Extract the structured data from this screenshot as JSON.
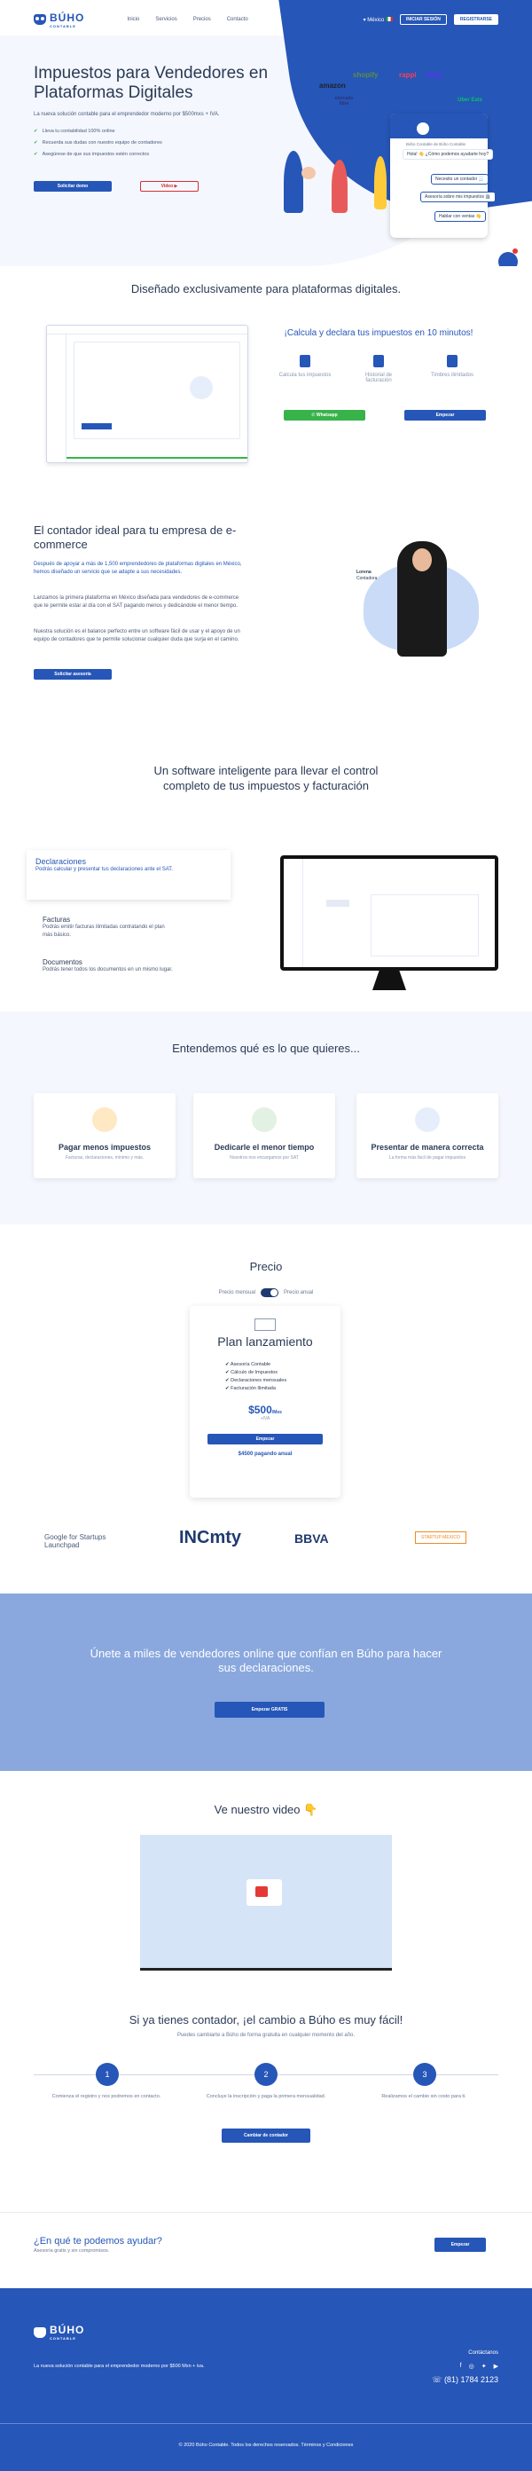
{
  "brand": {
    "name": "BÚHO",
    "sub": "CONTABLE"
  },
  "nav": {
    "links": [
      "Inicio",
      "Servicios",
      "Precios",
      "Contacto"
    ],
    "country": "México",
    "login": "INICIAR SESIÓN",
    "register": "REGISTRARSE"
  },
  "hero": {
    "title": "Impuestos para Vendedores en Plataformas Digitales",
    "subtitle": "La nueva solución contable para el emprendedor moderno por $500mxs + IVA.",
    "checks": [
      "Lleva tu contabilidad 100% online",
      "Recuerda sus dudas con nuestro equipo de contadores",
      "Asegúrese de que sus impuestos estén correctos"
    ],
    "cta_demo": "Solicitar demo",
    "cta_video": "Video",
    "brands": [
      "amazon",
      "shopify",
      "rappi",
      "shop",
      "mercado libre",
      "Uber Eats"
    ],
    "chat": {
      "header": "Búho Contable de Búho Contable",
      "greet": "Hola! 👋 ¿Cómo podemos ayudarte hoy?",
      "opt1": "Necesito un contador 🧾",
      "opt2": "Asesoría sobre mis impuestos 🏛️",
      "opt3": "Hablar con ventas 👋"
    }
  },
  "platforms": {
    "title": "Diseñado exclusivamente para plataformas digitales.",
    "headline": "¡Calcula y declara tus impuestos en 10 minutos!",
    "features": [
      "Calcula tus impuestos",
      "Historial de facturación",
      "Timbres ilimitados"
    ],
    "whatsapp": "Whatsapp",
    "start": "Empezar"
  },
  "accountant": {
    "title": "El contador ideal para tu empresa de e-commerce",
    "p1": "Después de apoyar a más de 1,500 emprendedores de plataformas digitales en México, hemos diseñado un servicio que se adapte a sus necesidades.",
    "p2": "Lanzamos la primera plataforma en México diseñada para vendedores de e-commerce que te permite estar al día con el SAT pagando menos y dedicándole el menor tiempo.",
    "p3": "Nuestra solución es el balance perfecto entre un software fácil de usar y el apoyo de un equipo de contadores que te permite solucionar cualquier duda que surja en el camino.",
    "cta": "Solicitar asesoría",
    "person_name": "Lorena",
    "person_role": "Contadora"
  },
  "software": {
    "title": "Un software inteligente para llevar el control completo de tus impuestos y facturación",
    "tabs": [
      {
        "title": "Declaraciones",
        "text": "Podrás calcular y presentar tus declaraciones ante el SAT."
      },
      {
        "title": "Facturas",
        "text": "Podrás emitir facturas ilimitadas contratando el plan más básico."
      },
      {
        "title": "Documentos",
        "text": "Podrás tener todos los documentos en un mismo lugar."
      }
    ]
  },
  "understand": {
    "title": "Entendemos qué es lo que quieres...",
    "cards": [
      {
        "title": "Pagar menos impuestos",
        "text": "Facturas, declaraciones, mínimo y más."
      },
      {
        "title": "Dedicarle el menor tiempo",
        "text": "Nosotros nos encargamos por SAT"
      },
      {
        "title": "Presentar de manera correcta",
        "text": "La forma más fácil de pagar impuestos"
      }
    ]
  },
  "price": {
    "title": "Precio",
    "monthly": "Precio mensual",
    "annual": "Precio anual",
    "plan": "Plan lanzamiento",
    "features": [
      "Asesoría Contable",
      "Cálculo de Impuestos",
      "Declaraciones mensuales",
      "Facturación Ilimitada"
    ],
    "amount": "$500",
    "period": "/Mes",
    "tax": "+IVA",
    "cta": "Empezar",
    "annual_note": "$4500 pagando anual"
  },
  "logos": [
    "Google for Startups Launchpad",
    "INCmty",
    "BBVA",
    "STARTUP MEXICO"
  ],
  "banner": {
    "title": "Únete a miles de vendedores online que confían en Búho para hacer sus declaraciones.",
    "cta": "Empezar GRATIS"
  },
  "video": {
    "title": "Ve nuestro video 👇"
  },
  "switch": {
    "title": "Si ya tienes contador, ¡el cambio a Búho es muy fácil!",
    "subtitle": "Puedes cambiarte a Búho de forma gratuita en cualquier momento del año.",
    "steps": [
      {
        "n": "1",
        "text": "Comienza el registro y nos podremos en contacto."
      },
      {
        "n": "2",
        "text": "Concluye la inscripción y paga la primera mensualidad."
      },
      {
        "n": "3",
        "text": "Realizamos el cambio sin costo para ti."
      }
    ],
    "cta": "Cambiar de contador"
  },
  "help": {
    "title": "¿En qué te podemos ayudar?",
    "subtitle": "Asesoría gratis y sin compromisos.",
    "cta": "Empezar"
  },
  "footer": {
    "tagline": "La nueva solución contable para el emprendedor moderno por $500 Mxn + iva.",
    "contact": "Contáctanos",
    "phone": "(81) 1784 2123",
    "copyright": "© 2020 Búho Contable. Todos los derechos reservados. Términos y Condiciones"
  },
  "colors": {
    "primary": "#2656b7",
    "banner": "#8aa8de",
    "soft": "#f4f7fd",
    "whatsapp": "#37b34a"
  }
}
